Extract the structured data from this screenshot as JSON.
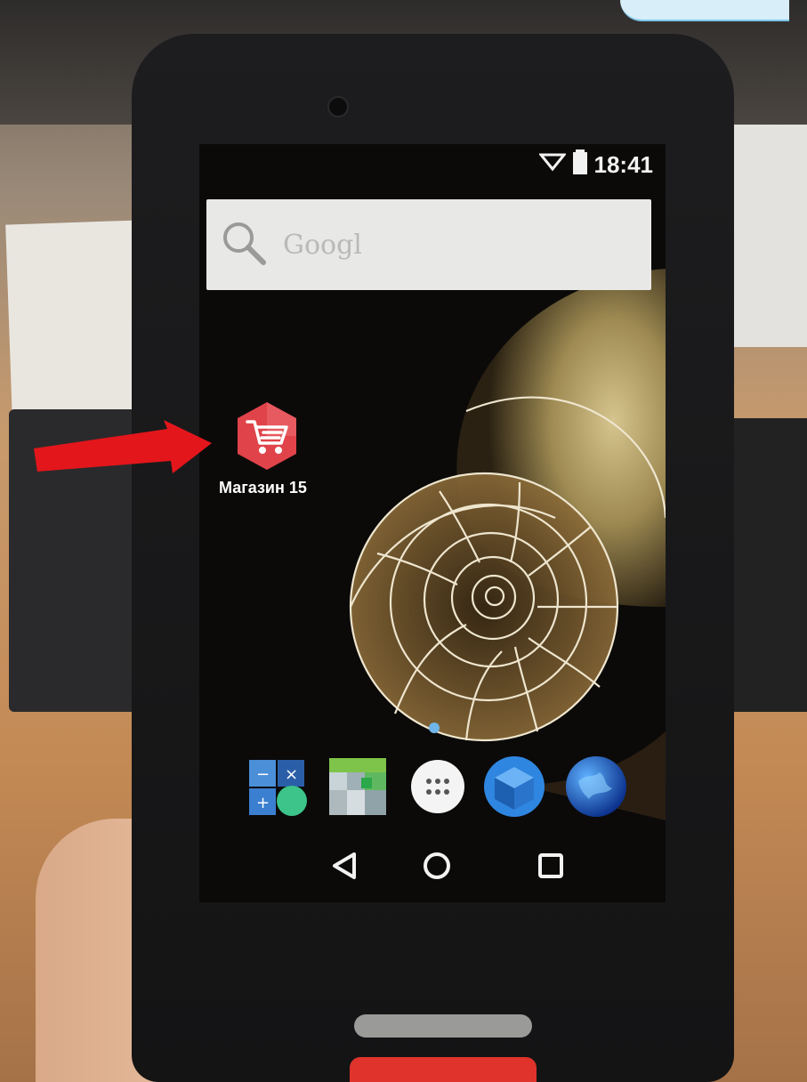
{
  "status_bar": {
    "time": "18:41",
    "wifi_icon": "wifi-icon",
    "battery_icon": "battery-icon"
  },
  "search": {
    "placeholder_text": "Googl",
    "icon": "search-icon"
  },
  "home_screen": {
    "app": {
      "label": "Магазин 15",
      "icon": "shopping-cart-icon",
      "icon_color": "#e0434a"
    },
    "dock": [
      {
        "name": "calculator-icon"
      },
      {
        "name": "tiles-app-icon"
      },
      {
        "name": "app-drawer-icon"
      },
      {
        "name": "cube-app-icon"
      },
      {
        "name": "globe-app-icon"
      }
    ],
    "nav": [
      {
        "name": "back-icon"
      },
      {
        "name": "home-icon"
      },
      {
        "name": "recents-icon"
      }
    ]
  },
  "annotation": {
    "arrow_color": "#e3161b"
  }
}
